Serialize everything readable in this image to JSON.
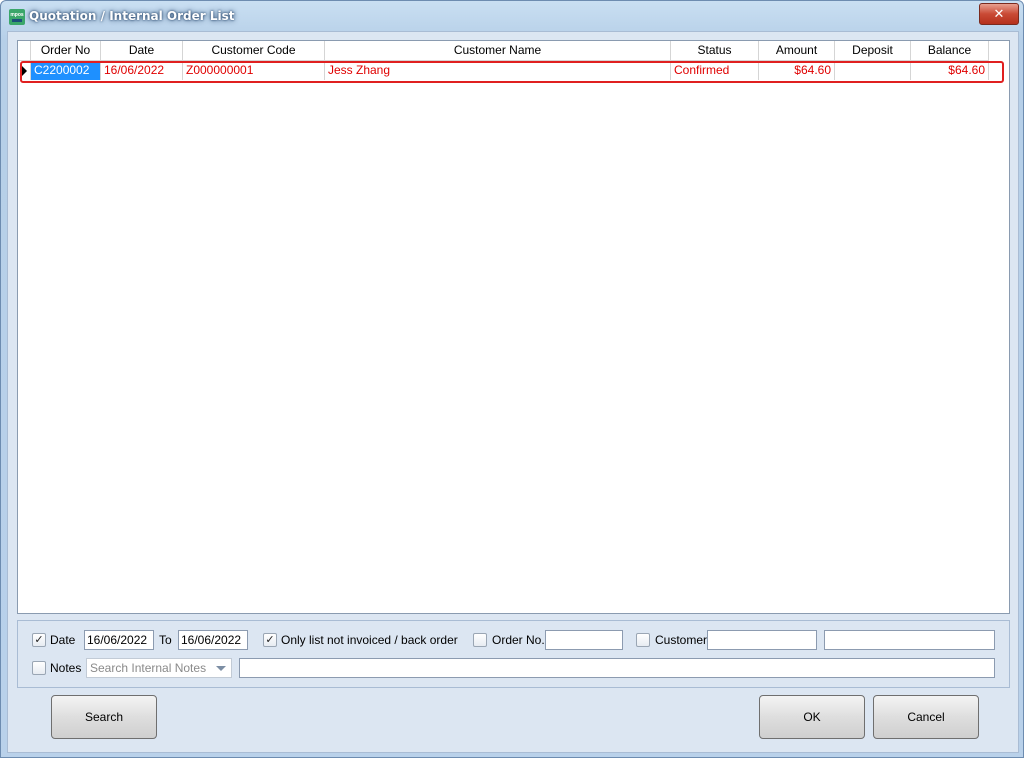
{
  "window": {
    "title": "Quotation / Internal Order List",
    "app_icon_text": "mpos",
    "close_glyph": "✕"
  },
  "grid": {
    "columns": [
      {
        "key": "order_no",
        "label": "Order No"
      },
      {
        "key": "date",
        "label": "Date"
      },
      {
        "key": "customer_code",
        "label": "Customer Code"
      },
      {
        "key": "customer_name",
        "label": "Customer Name"
      },
      {
        "key": "status",
        "label": "Status"
      },
      {
        "key": "amount",
        "label": "Amount"
      },
      {
        "key": "deposit",
        "label": "Deposit"
      },
      {
        "key": "balance",
        "label": "Balance"
      }
    ],
    "rows": [
      {
        "order_no": "C2200002",
        "date": "16/06/2022",
        "customer_code": "Z000000001",
        "customer_name": "Jess Zhang",
        "status": "Confirmed",
        "amount": "$64.60",
        "deposit": "",
        "balance": "$64.60"
      }
    ]
  },
  "filters": {
    "date_label": "Date",
    "date_checked": "✓",
    "date_from": "16/06/2022",
    "to_label": "To",
    "date_to": "16/06/2022",
    "not_invoiced_checked": "✓",
    "not_invoiced_label": "Only list not invoiced / back order",
    "order_no_label": "Order No.",
    "order_no_value": "",
    "customer_label": "Customer",
    "customer_value": "",
    "customer_name_value": "",
    "notes_label": "Notes",
    "notes_placeholder": "Search Internal Notes",
    "notes_value": ""
  },
  "buttons": {
    "search": "Search",
    "ok": "OK",
    "cancel": "Cancel"
  },
  "colors": {
    "row_text": "#e00000",
    "selected_cell": "#1e90ff",
    "highlight_border": "#e02020"
  }
}
